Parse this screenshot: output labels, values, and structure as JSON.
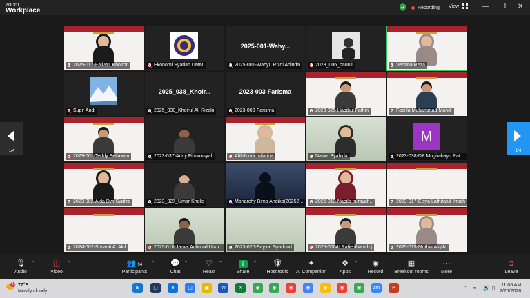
{
  "app": {
    "brand_line1": "zoom",
    "brand_line2": "Workplace"
  },
  "topbar": {
    "recording_label": "Recording",
    "view_label": "View"
  },
  "tiles": [
    {
      "name": "2025-017-Failatul Khoirot",
      "style": "banner",
      "person": "hijab-black"
    },
    {
      "name": "Ekonomi Syariah UMM",
      "style": "dark",
      "person": "logo"
    },
    {
      "name": "2025-001-Wahyu Rizqi Adinda",
      "style": "dark",
      "person": "none",
      "bigname": "2025-001-Wahy..."
    },
    {
      "name": "2023_006_pauull",
      "style": "dark",
      "person": "photo"
    },
    {
      "name": "Vebrina Reza",
      "style": "banner",
      "person": "hijab-gray",
      "active": true
    },
    {
      "name": "Supri Andi",
      "style": "dark",
      "person": "mountain"
    },
    {
      "name": "2025_038_Khoirul Ali Rizaki",
      "style": "dark",
      "person": "none",
      "bigname": "2025_038_Khoir..."
    },
    {
      "name": "2023-003-Farisma",
      "style": "dark",
      "person": "none",
      "bigname": "2023-003-Farisma"
    },
    {
      "name": "2023-025-Habibul Fathin",
      "style": "banner",
      "person": "man"
    },
    {
      "name": "Fadilla Muhammad Mahdi",
      "style": "banner",
      "person": "man-glasses"
    },
    {
      "name": "2023-001-Teddy Setiawan",
      "style": "banner",
      "person": "man"
    },
    {
      "name": "2023-037-Andy Firmansyah",
      "style": "dark",
      "person": "man-dark"
    },
    {
      "name": "Afifah nur milatina",
      "style": "banner",
      "person": "hijab-beige"
    },
    {
      "name": "Najwa Syahida",
      "style": "greenish",
      "person": "hijab-dark"
    },
    {
      "name": "2023-038-DP Mugirahayu Rat...",
      "style": "dark",
      "person": "m-avatar"
    },
    {
      "name": "2023-002-Aida Dwi Syafira",
      "style": "banner",
      "person": "hijab-black"
    },
    {
      "name": "2023_027_Umar Kholis",
      "style": "dark",
      "person": "man-light"
    },
    {
      "name": "Monarchy Bima Andika(20252...",
      "style": "sky",
      "person": "silhouette"
    },
    {
      "name": "2025-013-Nabila nursyaf...",
      "style": "banner",
      "person": "hijab-red"
    },
    {
      "name": "2023-017-Eisya Lathifatul Ilmiah",
      "style": "banner",
      "person": "none"
    },
    {
      "name": "2024-002-Susanti A. Akil",
      "style": "banner",
      "person": "none"
    },
    {
      "name": "2025-010-Jamal Achmad Usm...",
      "style": "greenish",
      "person": "man-dark"
    },
    {
      "name": "2023-020-Sayyaf Syaddad",
      "style": "greenish",
      "person": "blank"
    },
    {
      "name": "2025-0004- Rafie ilham h.j",
      "style": "banner",
      "person": "man"
    },
    {
      "name": "2025-015-Mutbia Asyifa",
      "style": "banner",
      "person": "hijab-gray"
    }
  ],
  "nav": {
    "left_page": "1/4",
    "right_page": "1/4"
  },
  "toolbar": {
    "audio": "Audio",
    "video": "Video",
    "participants": "Participants",
    "participants_count": "94",
    "chat": "Chat",
    "react": "React",
    "share": "Share",
    "host_tools": "Host tools",
    "ai_companion": "AI Companion",
    "apps": "Apps",
    "record": "Record",
    "breakout_rooms": "Breakout rooms",
    "more": "More",
    "leave": "Leave",
    "m_avatar_letter": "M"
  },
  "taskbar": {
    "temp": "77°F",
    "weather": "Mostly cloudy",
    "badge": "1",
    "time": "11:06 AM",
    "date": "2/25/2026"
  },
  "colors": {
    "accent": "#2196f3",
    "banner_red": "#a8232d",
    "recording_red": "#e5484d",
    "active_green": "#34c759"
  }
}
